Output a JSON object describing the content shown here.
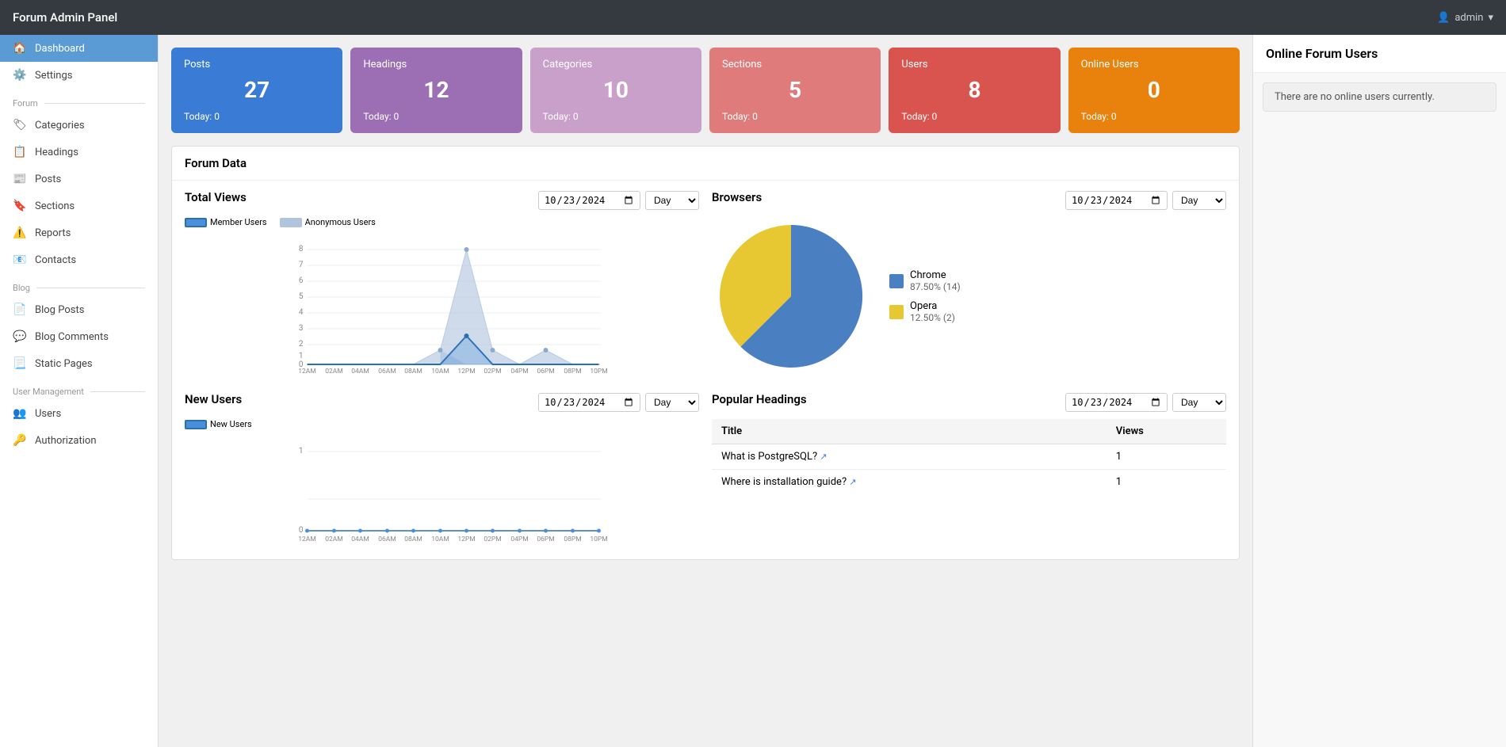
{
  "topbar": {
    "title": "Forum Admin Panel",
    "user": "admin"
  },
  "sidebar": {
    "items": [
      {
        "id": "dashboard",
        "label": "Dashboard",
        "icon": "🏠",
        "active": true,
        "section": null
      },
      {
        "id": "settings",
        "label": "Settings",
        "icon": "⚙️",
        "active": false,
        "section": null
      },
      {
        "id": "forum-section",
        "label": "Forum",
        "type": "section"
      },
      {
        "id": "categories",
        "label": "Categories",
        "icon": "🏷",
        "active": false,
        "section": "forum"
      },
      {
        "id": "headings",
        "label": "Headings",
        "icon": "📋",
        "active": false,
        "section": "forum"
      },
      {
        "id": "posts",
        "label": "Posts",
        "icon": "📰",
        "active": false,
        "section": "forum"
      },
      {
        "id": "sections",
        "label": "Sections",
        "icon": "🔖",
        "active": false,
        "section": "forum"
      },
      {
        "id": "reports",
        "label": "Reports",
        "icon": "⚠️",
        "active": false,
        "section": "forum"
      },
      {
        "id": "contacts",
        "label": "Contacts",
        "icon": "📧",
        "active": false,
        "section": "forum"
      },
      {
        "id": "blog-section",
        "label": "Blog",
        "type": "section"
      },
      {
        "id": "blog-posts",
        "label": "Blog Posts",
        "icon": "📄",
        "active": false,
        "section": "blog"
      },
      {
        "id": "blog-comments",
        "label": "Blog Comments",
        "icon": "💬",
        "active": false,
        "section": "blog"
      },
      {
        "id": "static-pages",
        "label": "Static Pages",
        "icon": "📃",
        "active": false,
        "section": "blog"
      },
      {
        "id": "usermgmt-section",
        "label": "User Management",
        "type": "section"
      },
      {
        "id": "users",
        "label": "Users",
        "icon": "👥",
        "active": false,
        "section": "usermgmt"
      },
      {
        "id": "authorization",
        "label": "Authorization",
        "icon": "🔑",
        "active": false,
        "section": "usermgmt"
      }
    ]
  },
  "stat_cards": [
    {
      "id": "posts",
      "label": "Posts",
      "value": "27",
      "today": "Today: 0",
      "color_class": "card-blue"
    },
    {
      "id": "headings",
      "label": "Headings",
      "value": "12",
      "today": "Today: 0",
      "color_class": "card-purple"
    },
    {
      "id": "categories",
      "label": "Categories",
      "value": "10",
      "today": "Today: 0",
      "color_class": "card-pink-light"
    },
    {
      "id": "sections",
      "label": "Sections",
      "value": "5",
      "today": "Today: 0",
      "color_class": "card-salmon"
    },
    {
      "id": "users",
      "label": "Users",
      "value": "8",
      "today": "Today: 0",
      "color_class": "card-red"
    },
    {
      "id": "online-users",
      "label": "Online Users",
      "value": "0",
      "today": "Today: 0",
      "color_class": "card-orange"
    }
  ],
  "forum_data": {
    "title": "Forum Data"
  },
  "total_views": {
    "title": "Total Views",
    "date": "10/23/2024",
    "period": "Day",
    "legend_member": "Member Users",
    "legend_anonymous": "Anonymous Users",
    "x_labels": [
      "12AM",
      "02AM",
      "04AM",
      "06AM",
      "08AM",
      "10AM",
      "12PM",
      "02PM",
      "04PM",
      "06PM",
      "08PM",
      "10PM"
    ],
    "member_data": [
      0,
      0,
      0,
      0,
      0,
      0,
      2,
      0,
      0,
      0,
      0,
      0
    ],
    "anonymous_data": [
      0,
      0,
      0,
      0,
      0,
      1,
      8,
      1,
      0,
      1,
      0,
      0
    ]
  },
  "browsers": {
    "title": "Browsers",
    "date": "10/23/2024",
    "period": "Day",
    "chrome_label": "Chrome",
    "chrome_value": "87.50% (14)",
    "opera_label": "Opera",
    "opera_value": "12.50% (2)",
    "chrome_pct": 87.5,
    "opera_pct": 12.5
  },
  "new_users": {
    "title": "New Users",
    "date": "10/23/2024",
    "period": "Day",
    "legend_label": "New Users",
    "x_labels": [
      "12AM",
      "02AM",
      "04AM",
      "06AM",
      "08AM",
      "10AM",
      "12PM",
      "02PM",
      "04PM",
      "06PM",
      "08PM",
      "10PM"
    ],
    "data": [
      0,
      0,
      0,
      0,
      0,
      0,
      0,
      0,
      0,
      0,
      0,
      0
    ]
  },
  "popular_headings": {
    "title": "Popular Headings",
    "date": "10/23/2024",
    "period": "Day",
    "col_title": "Title",
    "col_views": "Views",
    "rows": [
      {
        "title": "What is PostgreSQL?",
        "views": "1"
      },
      {
        "title": "Where is installation guide?",
        "views": "1"
      }
    ]
  },
  "online_users": {
    "title": "Online Forum Users",
    "message": "There are no online users currently."
  }
}
